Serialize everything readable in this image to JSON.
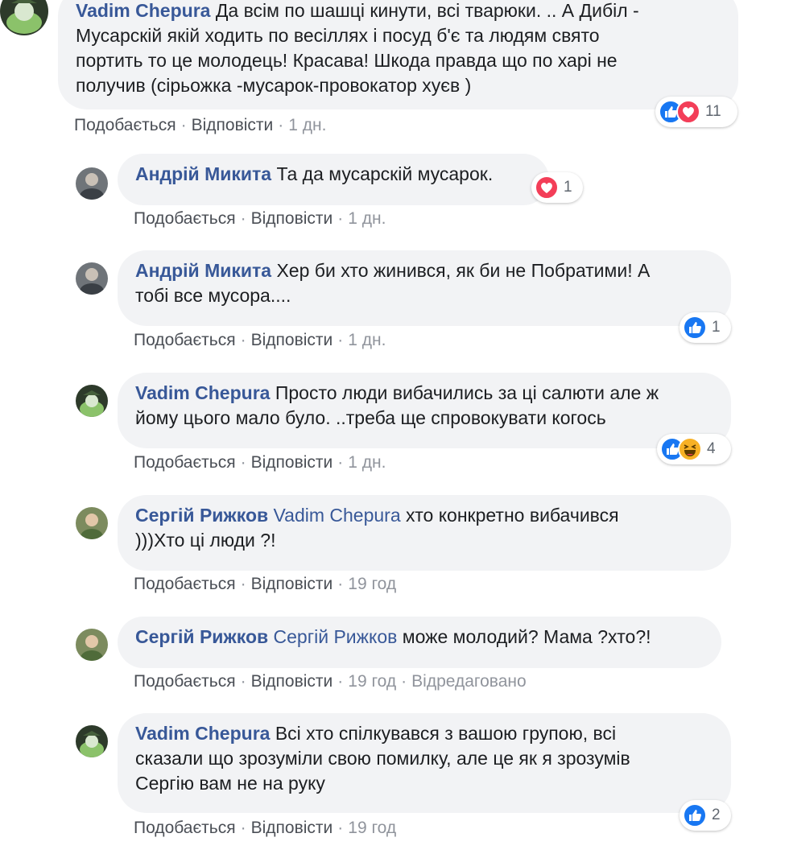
{
  "actions": {
    "like": "Подобається",
    "reply": "Відповісти",
    "edited": "Відредаговано"
  },
  "comments": [
    {
      "author": "Vadim Chepura",
      "lines": [
        "Да всім по шашці кинути, всі тварюки. .. А Дибіл -",
        "Мусарскій якій ходить по весіллях і посуд б'є та людям свято",
        "портить то це молодець! Красава! Шкода правда що по харі не",
        "получив (сірьожка -мусарок-провокатор хуєв )"
      ],
      "time": "1 дн.",
      "reactions": [
        "like",
        "love"
      ],
      "reaction_count": "11"
    },
    {
      "author": "Андрій Микита",
      "text": "Та да мусарскій мусарок.",
      "time": "1 дн.",
      "reactions": [
        "love"
      ],
      "reaction_count": "1"
    },
    {
      "author": "Андрій Микита",
      "lines": [
        "Хер би хто жинився, як би не Побратими! А",
        "тобі все мусора...."
      ],
      "time": "1 дн.",
      "reactions": [
        "like"
      ],
      "reaction_count": "1"
    },
    {
      "author": "Vadim Chepura",
      "lines": [
        "Просто люди вибачились за ці салюти але ж",
        "йому цього мало було. ..треба ще спровокувати когось"
      ],
      "time": "1 дн.",
      "reactions": [
        "like",
        "haha"
      ],
      "reaction_count": "4"
    },
    {
      "author": "Сергій Рижков",
      "mention": "Vadim Chepura",
      "lines": [
        "хто конкретно вибачився",
        ")))Хто ці люди ?!"
      ],
      "time": "19 год"
    },
    {
      "author": "Сергій Рижков",
      "mention": "Сергій Рижков",
      "text": "може молодий? Мама ?хто?!",
      "time": "19 год",
      "edited": true
    },
    {
      "author": "Vadim Chepura",
      "lines": [
        "Всі хто спілкувався з вашою групою, всі",
        "сказали що зрозуміли свою помилку, але це як я зрозумів",
        "Сергію вам не на руку"
      ],
      "time": "19 год",
      "reactions": [
        "like"
      ],
      "reaction_count": "2"
    }
  ],
  "colors": {
    "link": "#385898",
    "bubble": "#f2f3f5",
    "like": "#1877f2",
    "love": "#f33e58",
    "haha": "#f7b125"
  }
}
